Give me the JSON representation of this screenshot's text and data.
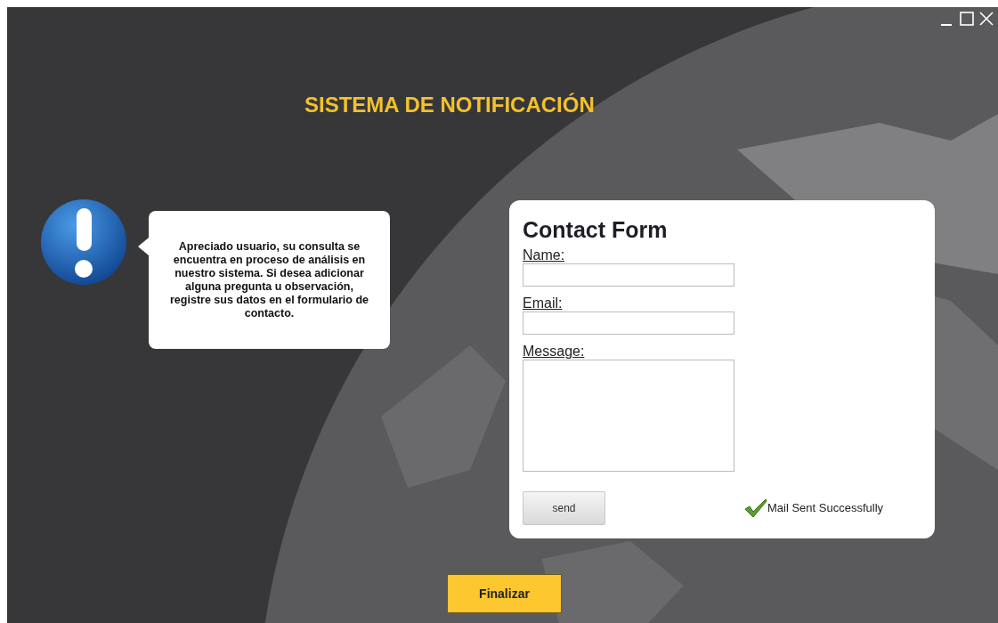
{
  "title": "SISTEMA DE NOTIFICACIÓN",
  "notice": {
    "message": "Apreciado usuario, su consulta se encuentra en proceso de análisis en nuestro sistema. Si desea adicionar alguna pregunta u observación, registre sus datos en el formulario de contacto."
  },
  "contact_form": {
    "title": "Contact Form",
    "fields": [
      {
        "label": "Name:",
        "kind": "input"
      },
      {
        "label": "Email:",
        "kind": "input"
      },
      {
        "label": "Message:",
        "kind": "textarea"
      }
    ],
    "send_button": "send",
    "status": "Mail Sent Successfully"
  },
  "finish_button": "Finalizar"
}
